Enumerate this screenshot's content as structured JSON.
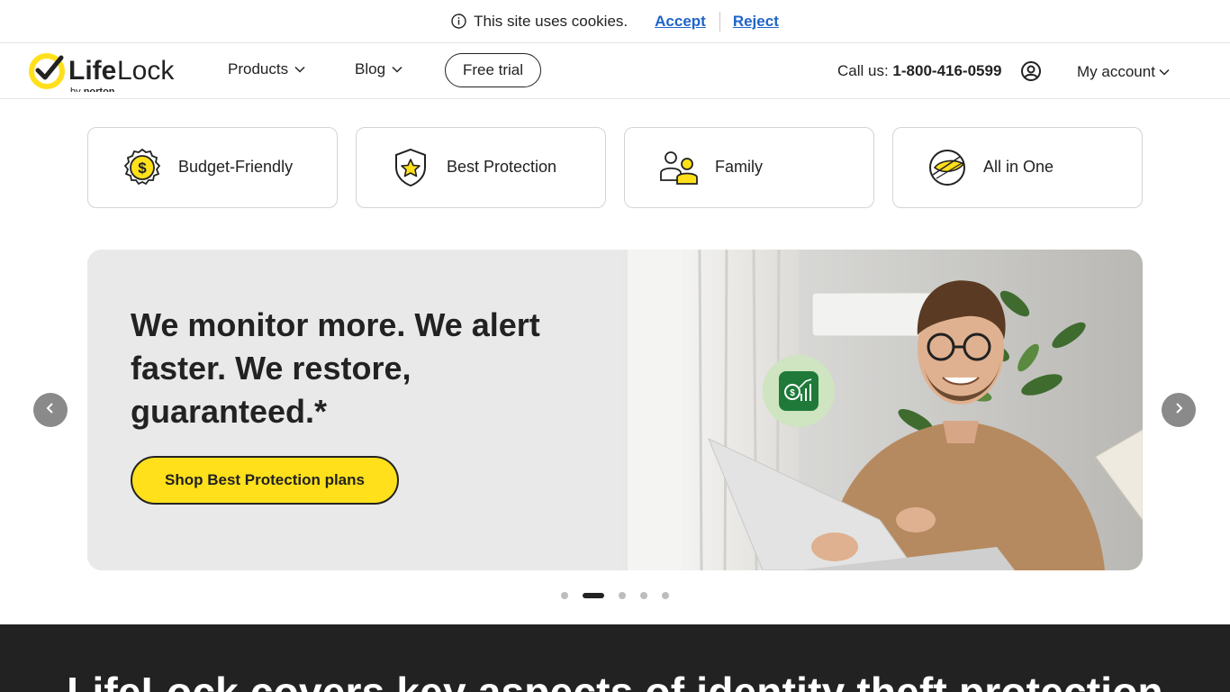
{
  "cookie": {
    "message": "This site uses cookies.",
    "accept": "Accept",
    "reject": "Reject"
  },
  "header": {
    "logo_text": "LifeLock",
    "logo_sub": "by norton",
    "nav": [
      {
        "label": "Products"
      },
      {
        "label": "Blog"
      }
    ],
    "free_trial": "Free trial",
    "call_prefix": "Call us:",
    "phone": "1-800-416-0599",
    "my_account": "My account"
  },
  "categories": [
    {
      "label": "Budget-Friendly",
      "icon": "dollar-badge-icon"
    },
    {
      "label": "Best Protection",
      "icon": "shield-star-icon"
    },
    {
      "label": "Family",
      "icon": "family-icon"
    },
    {
      "label": "All in One",
      "icon": "all-in-one-icon"
    }
  ],
  "hero": {
    "title": "We monitor more. We alert faster. We restore, guaranteed.*",
    "cta": "Shop Best Protection plans",
    "active_slide": 2,
    "slide_count": 5
  },
  "section": {
    "heading": "LifeLock covers key aspects of identity theft protection"
  },
  "colors": {
    "accent_yellow": "#ffe01b",
    "link_blue": "#1f64c8",
    "dark_bg": "#222222",
    "hero_bg": "#e9e9e9"
  }
}
